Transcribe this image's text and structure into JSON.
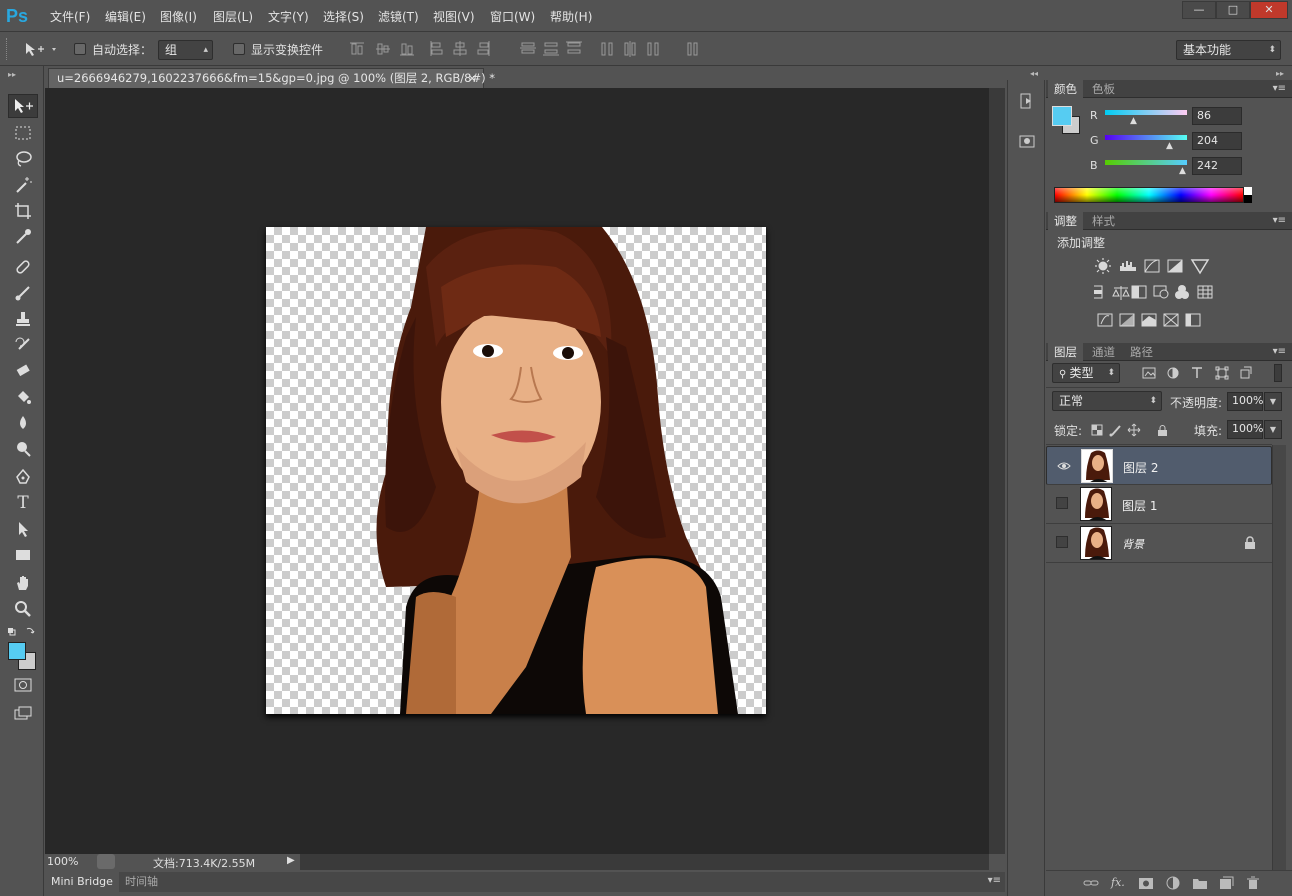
{
  "app": {
    "logo": "Ps"
  },
  "menu": [
    {
      "label": "文件(F)"
    },
    {
      "label": "编辑(E)"
    },
    {
      "label": "图像(I)"
    },
    {
      "label": "图层(L)"
    },
    {
      "label": "文字(Y)"
    },
    {
      "label": "选择(S)"
    },
    {
      "label": "滤镜(T)"
    },
    {
      "label": "视图(V)"
    },
    {
      "label": "窗口(W)"
    },
    {
      "label": "帮助(H)"
    }
  ],
  "window_controls": {
    "minimize": "—",
    "maximize": "□",
    "close": "✕"
  },
  "options": {
    "auto_select_label": "自动选择：",
    "auto_select_value": "组",
    "show_transform_label": "显示变换控件",
    "workspace": "基本功能"
  },
  "document": {
    "tab_title": "u=2666946279,1602237666&fm=15&gp=0.jpg @ 100% (图层 2, RGB/8#) *",
    "close": "×",
    "zoom": "100%",
    "doc_size": "文档:713.4K/2.55M"
  },
  "bottom_tabs": [
    {
      "label": "Mini Bridge"
    },
    {
      "label": "时间轴"
    }
  ],
  "color_panel": {
    "tabs": [
      {
        "label": "颜色"
      },
      {
        "label": "色板"
      }
    ],
    "fg_color": "#56ccf2",
    "bg_color": "#cccccc",
    "channels": [
      {
        "name": "R",
        "value": "86"
      },
      {
        "name": "G",
        "value": "204"
      },
      {
        "name": "B",
        "value": "242"
      }
    ]
  },
  "adjust_panel": {
    "tabs": [
      {
        "label": "调整"
      },
      {
        "label": "样式"
      }
    ],
    "title": "添加调整"
  },
  "layers_panel": {
    "tabs": [
      {
        "label": "图层"
      },
      {
        "label": "通道"
      },
      {
        "label": "路径"
      }
    ],
    "filter_kind": "类型",
    "blend_mode": "正常",
    "opacity_label": "不透明度:",
    "opacity": "100%",
    "lock_label": "锁定:",
    "fill_label": "填充:",
    "fill": "100%",
    "layers": [
      {
        "name": "图层 2",
        "visible": true,
        "selected": true
      },
      {
        "name": "图层 1",
        "visible": false,
        "selected": false
      },
      {
        "name": "背景",
        "visible": false,
        "selected": false,
        "locked": true
      }
    ]
  }
}
